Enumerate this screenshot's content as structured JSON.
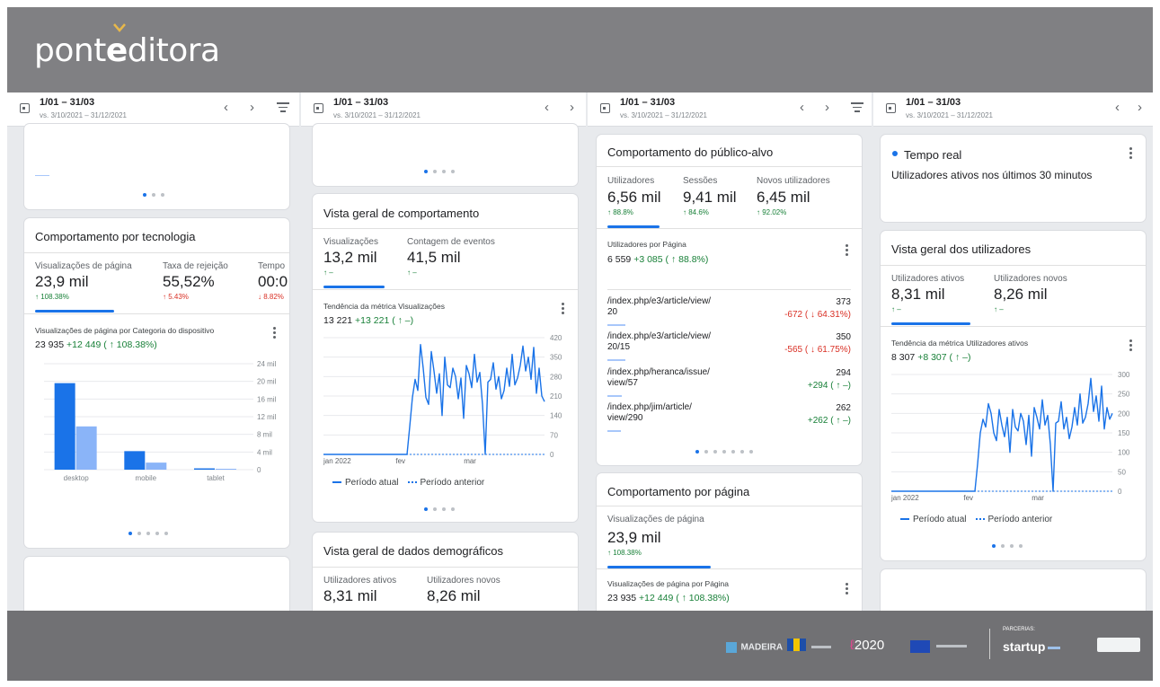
{
  "brand": {
    "logo_pre": "pont",
    "logo_bold": "e",
    "logo_post": "ditora"
  },
  "datebar": {
    "range": "1/01 – 31/03",
    "compare": "vs. 3/10/2021 – 31/12/2021"
  },
  "col1": {
    "tech": {
      "title": "Comportamento por tecnologia",
      "metrics": [
        {
          "label": "Visualizações de página",
          "value": "23,9 mil",
          "change": "↑ 108.38%"
        },
        {
          "label": "Taxa de rejeição",
          "value": "55,52%",
          "change": "↑ 5.43%"
        },
        {
          "label": "Tempo",
          "value": "00:0",
          "change": "↓ 8.82%"
        }
      ],
      "sub_title": "Visualizações de página por Categoria do dispositivo",
      "sub_total": "23 935",
      "sub_delta": "+12 449 ( ↑ 108.38%)"
    }
  },
  "col2": {
    "behavior": {
      "title": "Vista geral de comportamento",
      "metrics": [
        {
          "label": "Visualizações",
          "value": "13,2 mil",
          "change": "↑ –"
        },
        {
          "label": "Contagem de eventos",
          "value": "41,5 mil",
          "change": "↑ –"
        }
      ],
      "trend_title": "Tendência da métrica Visualizações",
      "trend_total": "13 221",
      "trend_delta": "+13 221 ( ↑ –)",
      "legend_current": "Período atual",
      "legend_previous": "Período anterior"
    },
    "demo": {
      "title": "Vista geral de dados demográficos",
      "metrics": [
        {
          "label": "Utilizadores ativos",
          "value": "8,31 mil"
        },
        {
          "label": "Utilizadores novos",
          "value": "8,26 mil"
        }
      ]
    }
  },
  "col3": {
    "audience": {
      "title": "Comportamento do público-alvo",
      "metrics": [
        {
          "label": "Utilizadores",
          "value": "6,56 mil",
          "change": "↑ 88.8%"
        },
        {
          "label": "Sessões",
          "value": "9,41 mil",
          "change": "↑ 84.6%"
        },
        {
          "label": "Novos utilizadores",
          "value": "6,45 mil",
          "change": "↑ 92.02%"
        }
      ],
      "sub_title": "Utilizadores por Página",
      "sub_total": "6 559",
      "sub_delta": "+3 085 ( ↑ 88.8%)",
      "rows": [
        {
          "path1": "/index.php/e3/article/view/",
          "path2": "20",
          "value": "373",
          "change": "-672 ( ↓ 64.31%)",
          "dir": "down",
          "bar": 1.0
        },
        {
          "path1": "/index.php/e3/article/view/",
          "path2": "20/15",
          "value": "350",
          "change": "-565 ( ↓ 61.75%)",
          "dir": "down",
          "bar": 0.94
        },
        {
          "path1": "/index.php/heranca/issue/",
          "path2": "view/57",
          "value": "294",
          "change": "+294 ( ↑ –)",
          "dir": "up",
          "bar": 0.79
        },
        {
          "path1": "/index.php/jim/article/",
          "path2": "view/290",
          "value": "262",
          "change": "+262 ( ↑ –)",
          "dir": "up",
          "bar": 0.7
        }
      ]
    },
    "page": {
      "title": "Comportamento por página",
      "metric_label": "Visualizações de página",
      "metric_value": "23,9 mil",
      "metric_change": "↑ 108.38%",
      "sub_title": "Visualizações de página por Página",
      "sub_total": "23 935",
      "sub_delta": "+12 449 ( ↑ 108.38%)"
    }
  },
  "col4": {
    "realtime": {
      "title": "Tempo real",
      "subtitle": "Utilizadores ativos nos últimos 30 minutos"
    },
    "users": {
      "title": "Vista geral dos utilizadores",
      "metrics": [
        {
          "label": "Utilizadores ativos",
          "value": "8,31 mil",
          "change": "↑ –"
        },
        {
          "label": "Utilizadores novos",
          "value": "8,26 mil",
          "change": "↑ –"
        }
      ],
      "trend_title": "Tendência da métrica Utilizadores ativos",
      "trend_total": "8 307",
      "trend_delta": "+8 307 ( ↑ –)",
      "legend_current": "Período atual",
      "legend_previous": "Período anterior"
    }
  },
  "footer": {
    "partners_label": "PARCERIAS:",
    "startup": "startup",
    "logos": [
      "MADEIRA",
      "2020"
    ]
  },
  "chart_data": [
    {
      "type": "bar",
      "title": "Visualizações de página por Categoria do dispositivo",
      "categories": [
        "desktop",
        "mobile",
        "tablet"
      ],
      "series": [
        {
          "name": "Período atual",
          "values": [
            19600,
            4200,
            300
          ]
        },
        {
          "name": "Período anterior",
          "values": [
            9800,
            1600,
            200
          ]
        }
      ],
      "y_ticks": [
        "24 mil",
        "20 mil",
        "16 mil",
        "12 mil",
        "8 mil",
        "4 mil",
        "0"
      ],
      "ylim": [
        0,
        24000
      ]
    },
    {
      "type": "line",
      "title": "Tendência da métrica Visualizações",
      "x_labels": [
        "jan 2022",
        "fev",
        "mar"
      ],
      "y_ticks": [
        "420",
        "350",
        "280",
        "210",
        "140",
        "70",
        "0"
      ],
      "ylim": [
        0,
        420
      ],
      "series": [
        {
          "name": "Período atual",
          "values": [
            0,
            0,
            0,
            0,
            0,
            0,
            0,
            0,
            0,
            0,
            0,
            0,
            0,
            0,
            0,
            0,
            0,
            0,
            0,
            0,
            0,
            0,
            0,
            0,
            0,
            0,
            0,
            0,
            0,
            0,
            0,
            0,
            100,
            205,
            270,
            230,
            395,
            310,
            205,
            180,
            370,
            300,
            220,
            290,
            140,
            350,
            250,
            240,
            310,
            280,
            200,
            275,
            130,
            320,
            290,
            240,
            360,
            260,
            295,
            180,
            0,
            260,
            270,
            330,
            235,
            280,
            200,
            230,
            310,
            245,
            360,
            250,
            275,
            320,
            390,
            300,
            350,
            270,
            385,
            220,
            310,
            210,
            190
          ]
        },
        {
          "name": "Período anterior",
          "values": []
        }
      ]
    },
    {
      "type": "line",
      "title": "Tendência da métrica Utilizadores ativos",
      "x_labels": [
        "jan 2022",
        "fev",
        "mar"
      ],
      "y_ticks": [
        "300",
        "250",
        "200",
        "150",
        "100",
        "50",
        "0"
      ],
      "ylim": [
        0,
        300
      ],
      "series": [
        {
          "name": "Período atual",
          "values": [
            0,
            0,
            0,
            0,
            0,
            0,
            0,
            0,
            0,
            0,
            0,
            0,
            0,
            0,
            0,
            0,
            0,
            0,
            0,
            0,
            0,
            0,
            0,
            0,
            0,
            0,
            0,
            0,
            0,
            0,
            0,
            0,
            70,
            150,
            185,
            165,
            225,
            200,
            150,
            130,
            210,
            170,
            140,
            190,
            100,
            210,
            165,
            155,
            200,
            180,
            120,
            195,
            90,
            215,
            190,
            160,
            235,
            170,
            195,
            120,
            0,
            175,
            180,
            230,
            160,
            190,
            135,
            165,
            215,
            170,
            250,
            175,
            190,
            225,
            290,
            205,
            245,
            180,
            270,
            160,
            215,
            185,
            200
          ]
        },
        {
          "name": "Período anterior",
          "values": []
        }
      ]
    }
  ]
}
